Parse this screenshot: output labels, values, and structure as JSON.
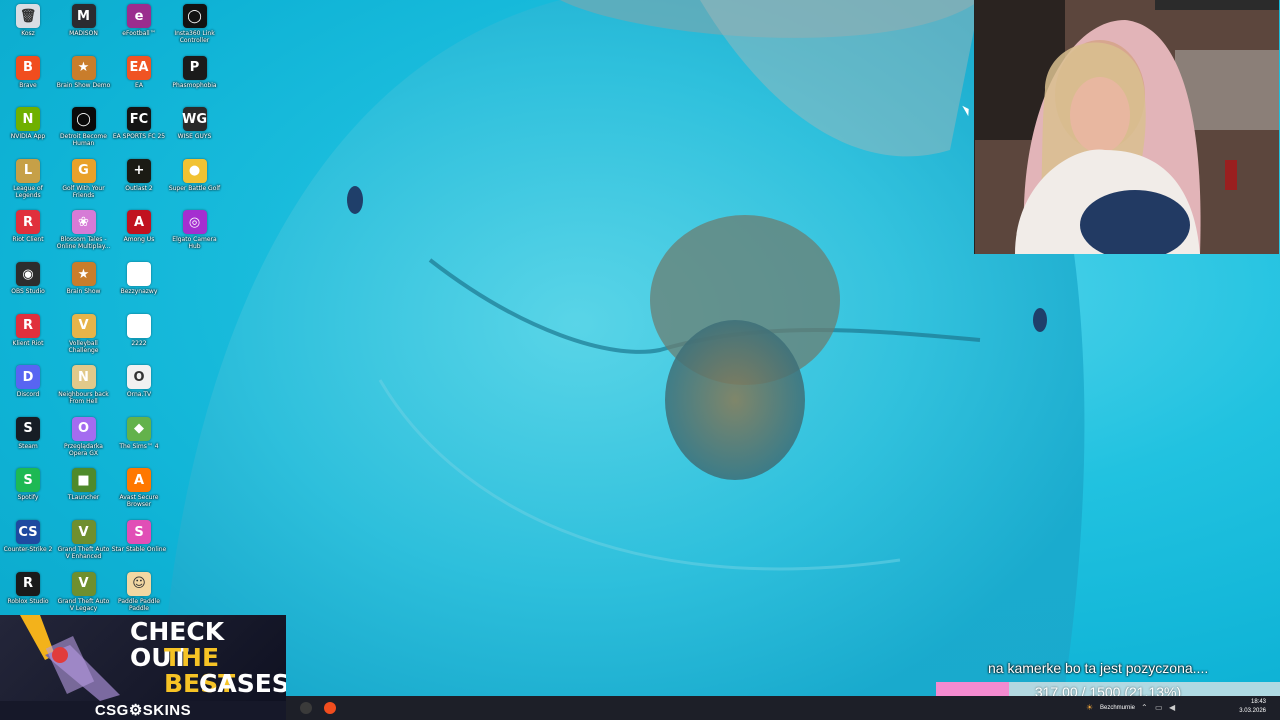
{
  "desktop": {
    "icons": [
      {
        "label": "Kosz",
        "col": 0,
        "row": 0,
        "color": "#d9dde3",
        "glyph": "🗑"
      },
      {
        "label": "MADISON",
        "col": 1,
        "row": 0,
        "color": "#2b2b30",
        "glyph": "M"
      },
      {
        "label": "eFootball™",
        "col": 2,
        "row": 0,
        "color": "#9b2d8e",
        "glyph": "e"
      },
      {
        "label": "Insta360 Link Controller",
        "col": 3,
        "row": 0,
        "color": "#121212",
        "glyph": "◯"
      },
      {
        "label": "Brave",
        "col": 0,
        "row": 1,
        "color": "#f14d1e",
        "glyph": "B"
      },
      {
        "label": "Brain Show Demo",
        "col": 1,
        "row": 1,
        "color": "#c97d2b",
        "glyph": "★"
      },
      {
        "label": "EA",
        "col": 2,
        "row": 1,
        "color": "#f05423",
        "glyph": "EA"
      },
      {
        "label": "Phasmophobia",
        "col": 3,
        "row": 1,
        "color": "#1b1b1b",
        "glyph": "P"
      },
      {
        "label": "NVIDIA App",
        "col": 0,
        "row": 2,
        "color": "#6fb000",
        "glyph": "N"
      },
      {
        "label": "Detroit Become Human",
        "col": 1,
        "row": 2,
        "color": "#0a0a0a",
        "glyph": "◯"
      },
      {
        "label": "EA SPORTS FC 25",
        "col": 2,
        "row": 2,
        "color": "#141414",
        "glyph": "FC"
      },
      {
        "label": "WISE GUYS",
        "col": 3,
        "row": 2,
        "color": "#2a2a2a",
        "glyph": "WG"
      },
      {
        "label": "League of Legends",
        "col": 0,
        "row": 3,
        "color": "#c6a047",
        "glyph": "L"
      },
      {
        "label": "Golf With Your Friends",
        "col": 1,
        "row": 3,
        "color": "#e9a12a",
        "glyph": "G"
      },
      {
        "label": "Outlast 2",
        "col": 2,
        "row": 3,
        "color": "#1b1b14",
        "glyph": "+"
      },
      {
        "label": "Super Battle Golf",
        "col": 3,
        "row": 3,
        "color": "#f1c232",
        "glyph": "●"
      },
      {
        "label": "Riot Client",
        "col": 0,
        "row": 4,
        "color": "#e0303c",
        "glyph": "R"
      },
      {
        "label": "Blossom Tales - Online Multiplay...",
        "col": 1,
        "row": 4,
        "color": "#d67bd6",
        "glyph": "❀"
      },
      {
        "label": "Among Us",
        "col": 2,
        "row": 4,
        "color": "#c1121f",
        "glyph": "A"
      },
      {
        "label": "Elgato Camera Hub",
        "col": 3,
        "row": 4,
        "color": "#a52fd0",
        "glyph": "◎"
      },
      {
        "label": "OBS Studio",
        "col": 0,
        "row": 5,
        "color": "#2d2d2d",
        "glyph": "◉"
      },
      {
        "label": "Brain Show",
        "col": 1,
        "row": 5,
        "color": "#c97d2b",
        "glyph": "★"
      },
      {
        "label": "Bezzynazwy",
        "col": 2,
        "row": 5,
        "color": "#ffffff",
        "glyph": ""
      },
      {
        "label": "Klient Riot",
        "col": 0,
        "row": 6,
        "color": "#e0303c",
        "glyph": "R"
      },
      {
        "label": "Volleyball Challenge",
        "col": 1,
        "row": 6,
        "color": "#e6b44a",
        "glyph": "V"
      },
      {
        "label": "2222",
        "col": 2,
        "row": 6,
        "color": "#ffffff",
        "glyph": ""
      },
      {
        "label": "Discord",
        "col": 0,
        "row": 7,
        "color": "#5865f2",
        "glyph": "D"
      },
      {
        "label": "Neighbours back From Hell",
        "col": 1,
        "row": 7,
        "color": "#e1c98a",
        "glyph": "N"
      },
      {
        "label": "Orna.TV",
        "col": 2,
        "row": 7,
        "color": "#f1f1f1",
        "glyph": "O"
      },
      {
        "label": "Steam",
        "col": 0,
        "row": 8,
        "color": "#171d25",
        "glyph": "S"
      },
      {
        "label": "Przeglądarka Opera GX",
        "col": 1,
        "row": 8,
        "color": "#a46cf0",
        "glyph": "O"
      },
      {
        "label": "The Sims™ 4",
        "col": 2,
        "row": 8,
        "color": "#63b24b",
        "glyph": "◆"
      },
      {
        "label": "Spotify",
        "col": 0,
        "row": 9,
        "color": "#1db954",
        "glyph": "S"
      },
      {
        "label": "TLauncher",
        "col": 1,
        "row": 9,
        "color": "#4f8a2b",
        "glyph": "■"
      },
      {
        "label": "Avast Secure Browser",
        "col": 2,
        "row": 9,
        "color": "#ff7800",
        "glyph": "A"
      },
      {
        "label": "Counter-Strike 2",
        "col": 0,
        "row": 10,
        "color": "#1f4aa0",
        "glyph": "CS"
      },
      {
        "label": "Grand Theft Auto V Enhanced",
        "col": 1,
        "row": 10,
        "color": "#6f8f2e",
        "glyph": "V"
      },
      {
        "label": "Star Stable Online",
        "col": 2,
        "row": 10,
        "color": "#e14fb6",
        "glyph": "S"
      },
      {
        "label": "Roblox Studio",
        "col": 0,
        "row": 11,
        "color": "#1a1a1a",
        "glyph": "R"
      },
      {
        "label": "Grand Theft Auto V Legacy",
        "col": 1,
        "row": 11,
        "color": "#6f8f2e",
        "glyph": "V"
      },
      {
        "label": "Paddle Paddle Paddle",
        "col": 2,
        "row": 11,
        "color": "#f2d7a2",
        "glyph": "☺"
      }
    ]
  },
  "ad": {
    "line1": "CHECK OUT",
    "line2": "THE BEST",
    "line3": "CASES",
    "brand": "CSG⚙SKINS"
  },
  "caption": "na kamerke bo ta jest pozyczona....",
  "goal": {
    "text": "317.00 / 1500 (21.13%)",
    "progress": 0.2113
  },
  "taskbar": {
    "apps": [
      {
        "name": "obs-taskbar-icon",
        "color": "#3a3a3a"
      },
      {
        "name": "brave-taskbar-icon",
        "color": "#f14d1e"
      }
    ],
    "weather": "Bezchmurnie",
    "time": "18:43",
    "date": "3.03.2026"
  }
}
